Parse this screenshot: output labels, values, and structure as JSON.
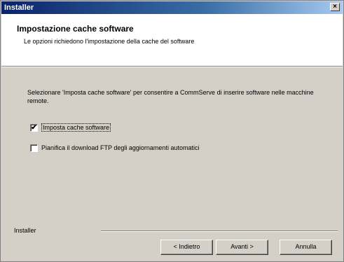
{
  "window": {
    "title": "Installer",
    "close_symbol": "×"
  },
  "header": {
    "title": "Impostazione cache software",
    "description": "Le opzioni richiedono l'impostazione della cache del software"
  },
  "body": {
    "intro": "Selezionare 'Imposta cache software' per consentire a CommServe di inserire software nelle macchine remote.",
    "options": [
      {
        "label": "Imposta cache software",
        "checked": true,
        "mark": "✔"
      },
      {
        "label": "Pianifica il download FTP degli aggiornamenti automatici",
        "checked": false,
        "mark": ""
      }
    ]
  },
  "footer": {
    "label": "Installer",
    "back_label": "< Indietro",
    "next_label": "Avanti >",
    "cancel_label": "Annulla"
  }
}
